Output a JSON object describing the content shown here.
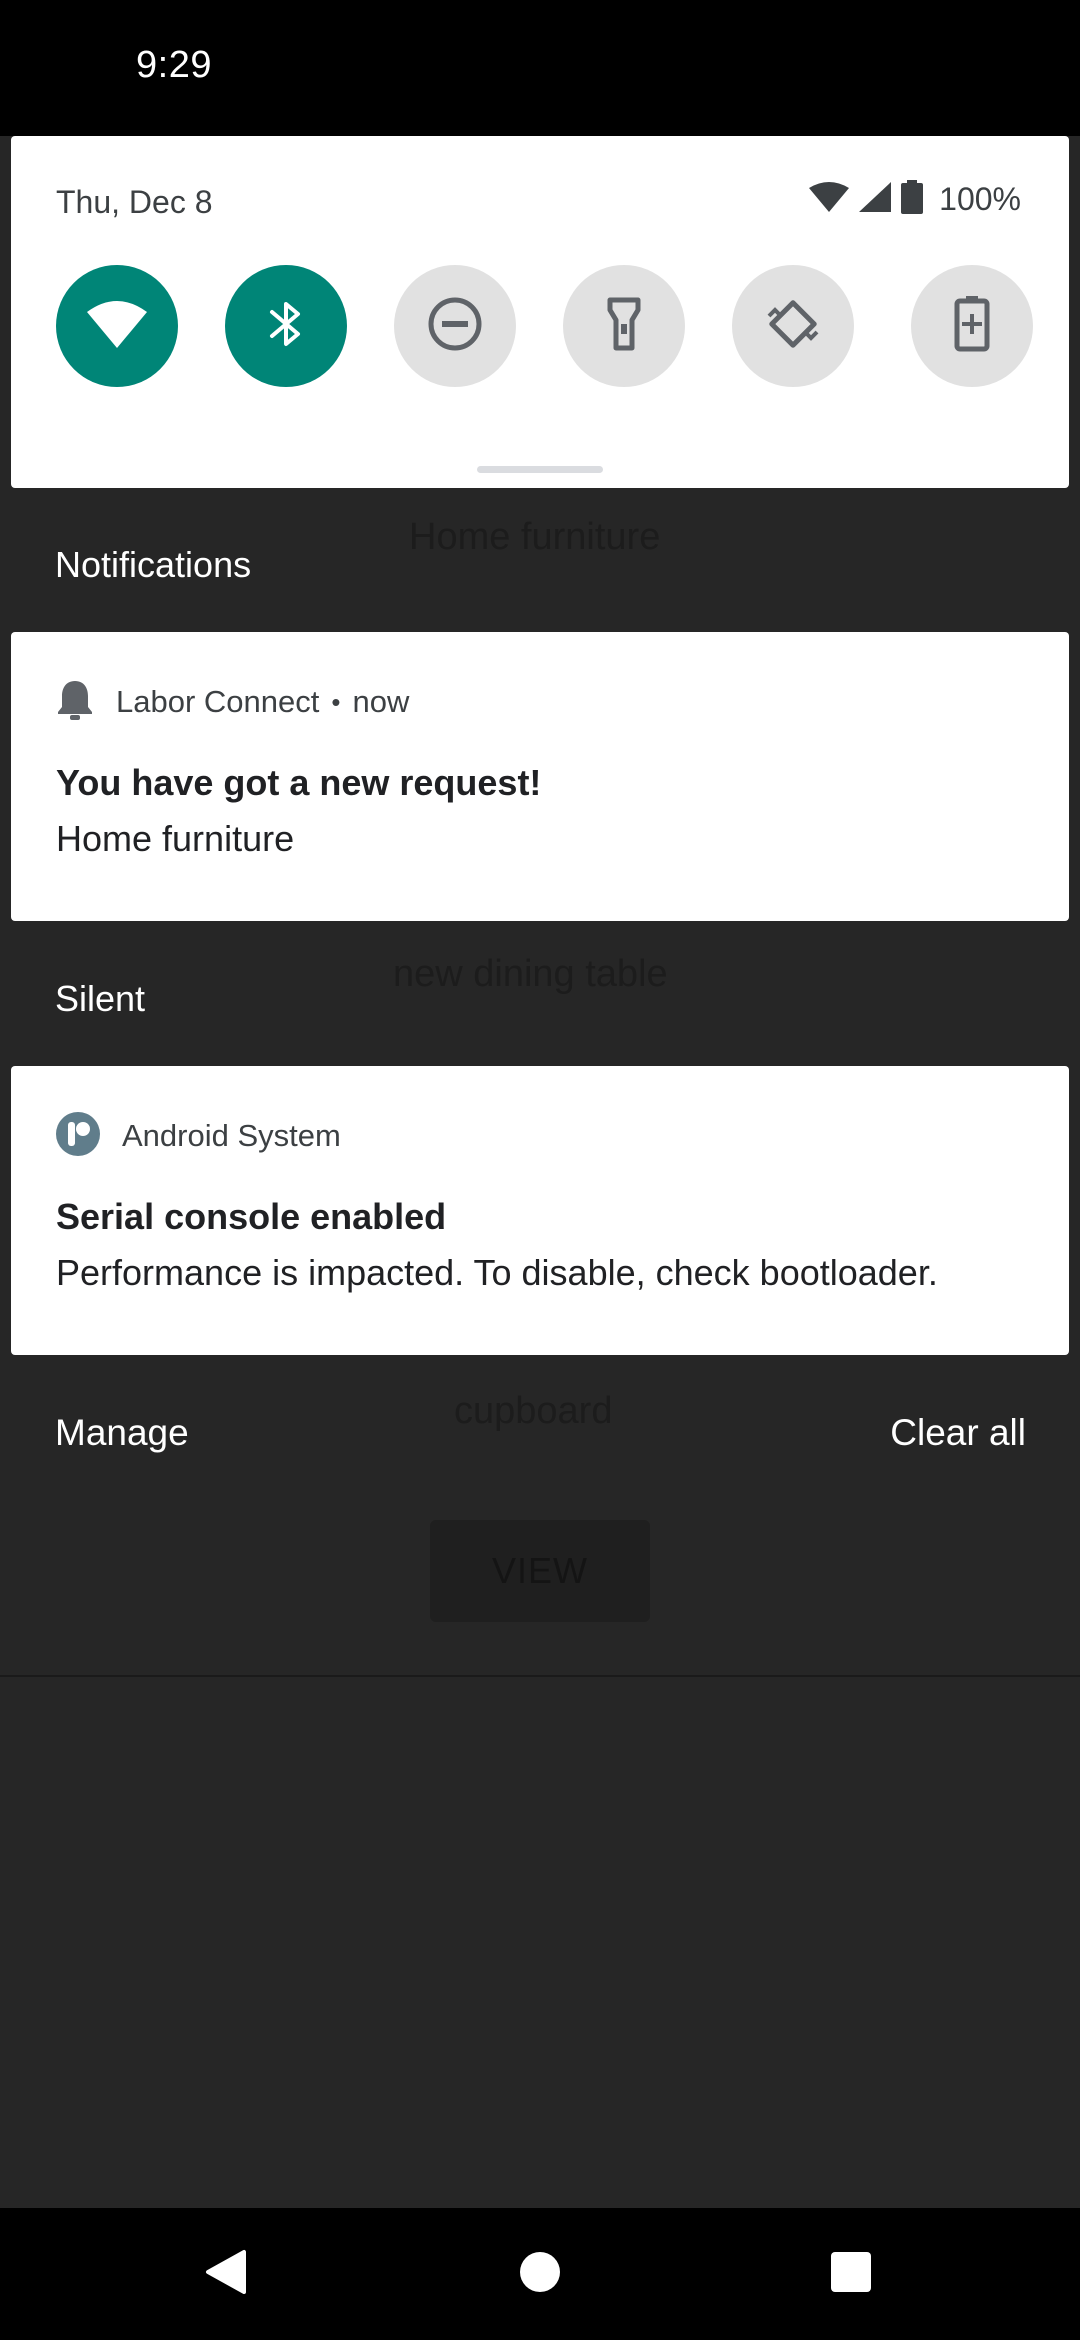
{
  "status_bar": {
    "time": "9:29"
  },
  "background_app": {
    "item_1": "Home furniture",
    "item_2": "new dining table",
    "item_3": "cupboard",
    "view_label": "VIEW"
  },
  "quick_settings": {
    "date": "Thu, Dec 8",
    "battery": "100%",
    "tiles": [
      {
        "name": "wifi",
        "icon": "wifi-icon",
        "state": "on"
      },
      {
        "name": "bluetooth",
        "icon": "bluetooth-icon",
        "state": "on"
      },
      {
        "name": "do-not-disturb",
        "icon": "do-not-disturb-icon",
        "state": "off"
      },
      {
        "name": "flashlight",
        "icon": "flashlight-icon",
        "state": "off"
      },
      {
        "name": "auto-rotate",
        "icon": "auto-rotate-icon",
        "state": "off"
      },
      {
        "name": "battery-saver",
        "icon": "battery-saver-icon",
        "state": "off"
      }
    ]
  },
  "sections": {
    "notifications": "Notifications",
    "silent": "Silent"
  },
  "notifications": [
    {
      "app": "Labor Connect",
      "separator": "•",
      "time": "now",
      "icon": "bell-icon",
      "title": "You have got a new request!",
      "body": "Home furniture"
    },
    {
      "app": "Android System",
      "icon": "android-system-icon",
      "title": "Serial console enabled",
      "body": "Performance is impacted. To disable, check bootloader."
    }
  ],
  "footer": {
    "manage": "Manage",
    "clear_all": "Clear all"
  },
  "colors": {
    "accent": "#008577",
    "tile_off": "#e1e1e1",
    "scrim": "#262626"
  }
}
